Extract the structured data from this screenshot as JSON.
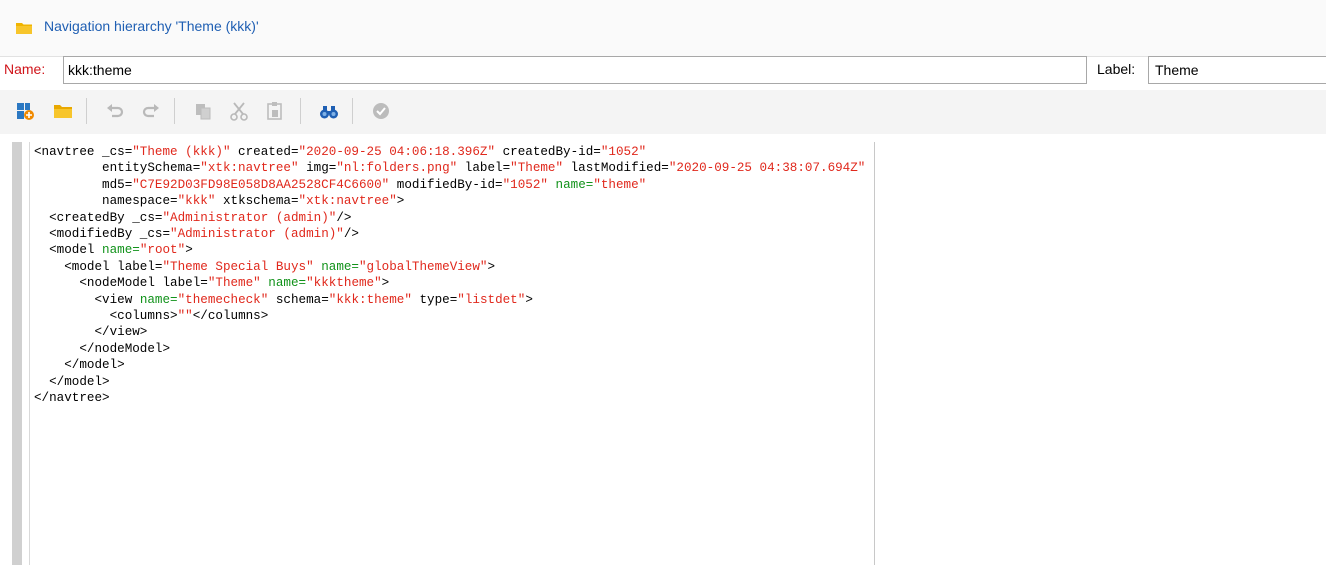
{
  "window": {
    "title": "Navigation hierarchy 'Theme (kkk)'",
    "icon": "folder-icon",
    "accent": "#1f5fb3"
  },
  "form": {
    "name_label": "Name:",
    "name_value": "kkk:theme",
    "label_label": "Label:",
    "label_value": "Theme",
    "required_color": "#d0141a"
  },
  "toolbar": {
    "buttons": [
      {
        "icon": "new-icon",
        "enabled": true
      },
      {
        "icon": "open-folder-icon",
        "enabled": true
      },
      {
        "icon": "undo-icon",
        "enabled": false
      },
      {
        "icon": "redo-icon",
        "enabled": false
      },
      {
        "icon": "copy-icon",
        "enabled": false
      },
      {
        "icon": "cut-icon",
        "enabled": false
      },
      {
        "icon": "paste-icon",
        "enabled": false
      },
      {
        "icon": "find-icon",
        "enabled": true
      },
      {
        "icon": "validate-icon",
        "enabled": false
      }
    ]
  },
  "editor": {
    "lines": [
      [
        [
          "t",
          "<navtree _cs="
        ],
        [
          "v",
          "\"Theme (kkk)\""
        ],
        [
          "t",
          " created="
        ],
        [
          "v",
          "\"2020-09-25 04:06:18.396Z\""
        ],
        [
          "t",
          " createdBy-id="
        ],
        [
          "v",
          "\"1052\""
        ]
      ],
      [
        [
          "t",
          "         entitySchema="
        ],
        [
          "v",
          "\"xtk:navtree\""
        ],
        [
          "t",
          " img="
        ],
        [
          "v",
          "\"nl:folders.png\""
        ],
        [
          "t",
          " label="
        ],
        [
          "v",
          "\"Theme\""
        ],
        [
          "t",
          " lastModified="
        ],
        [
          "v",
          "\"2020-09-25 04:38:07.694Z\""
        ]
      ],
      [
        [
          "t",
          "         md5="
        ],
        [
          "v",
          "\"C7E92D03FD98E058D8AA2528CF4C6600\""
        ],
        [
          "t",
          " modifiedBy-id="
        ],
        [
          "v",
          "\"1052\""
        ],
        [
          "t",
          " "
        ],
        [
          "g",
          "name="
        ],
        [
          "v",
          "\"theme\""
        ]
      ],
      [
        [
          "t",
          "         namespace="
        ],
        [
          "v",
          "\"kkk\""
        ],
        [
          "t",
          " xtkschema="
        ],
        [
          "v",
          "\"xtk:navtree\""
        ],
        [
          "t",
          ">"
        ]
      ],
      [
        [
          "t",
          "  <createdBy _cs="
        ],
        [
          "v",
          "\"Administrator (admin)\""
        ],
        [
          "t",
          "/>"
        ]
      ],
      [
        [
          "t",
          "  <modifiedBy _cs="
        ],
        [
          "v",
          "\"Administrator (admin)\""
        ],
        [
          "t",
          "/>"
        ]
      ],
      [
        [
          "t",
          "  <model "
        ],
        [
          "g",
          "name="
        ],
        [
          "v",
          "\"root\""
        ],
        [
          "t",
          ">"
        ]
      ],
      [
        [
          "t",
          "    <model label="
        ],
        [
          "v",
          "\"Theme Special Buys\""
        ],
        [
          "t",
          " "
        ],
        [
          "g",
          "name="
        ],
        [
          "v",
          "\"globalThemeView\""
        ],
        [
          "t",
          ">"
        ]
      ],
      [
        [
          "t",
          "      <nodeModel label="
        ],
        [
          "v",
          "\"Theme\""
        ],
        [
          "t",
          " "
        ],
        [
          "g",
          "name="
        ],
        [
          "v",
          "\"kkktheme\""
        ],
        [
          "t",
          ">"
        ]
      ],
      [
        [
          "t",
          "        <view "
        ],
        [
          "g",
          "name="
        ],
        [
          "v",
          "\"themecheck\""
        ],
        [
          "t",
          " schema="
        ],
        [
          "v",
          "\"kkk:theme\""
        ],
        [
          "t",
          " type="
        ],
        [
          "v",
          "\"listdet\""
        ],
        [
          "t",
          ">"
        ]
      ],
      [
        [
          "t",
          "          <columns>"
        ],
        [
          "v",
          "\"\""
        ],
        [
          "t",
          "</columns>"
        ]
      ],
      [
        [
          "t",
          "        </view>"
        ]
      ],
      [
        [
          "t",
          "      </nodeModel>"
        ]
      ],
      [
        [
          "t",
          "    </model>"
        ]
      ],
      [
        [
          "t",
          "  </model>"
        ]
      ],
      [
        [
          "t",
          "</navtree>"
        ]
      ]
    ],
    "value_color": "#e0281c",
    "name_attr_color": "#11921a"
  }
}
